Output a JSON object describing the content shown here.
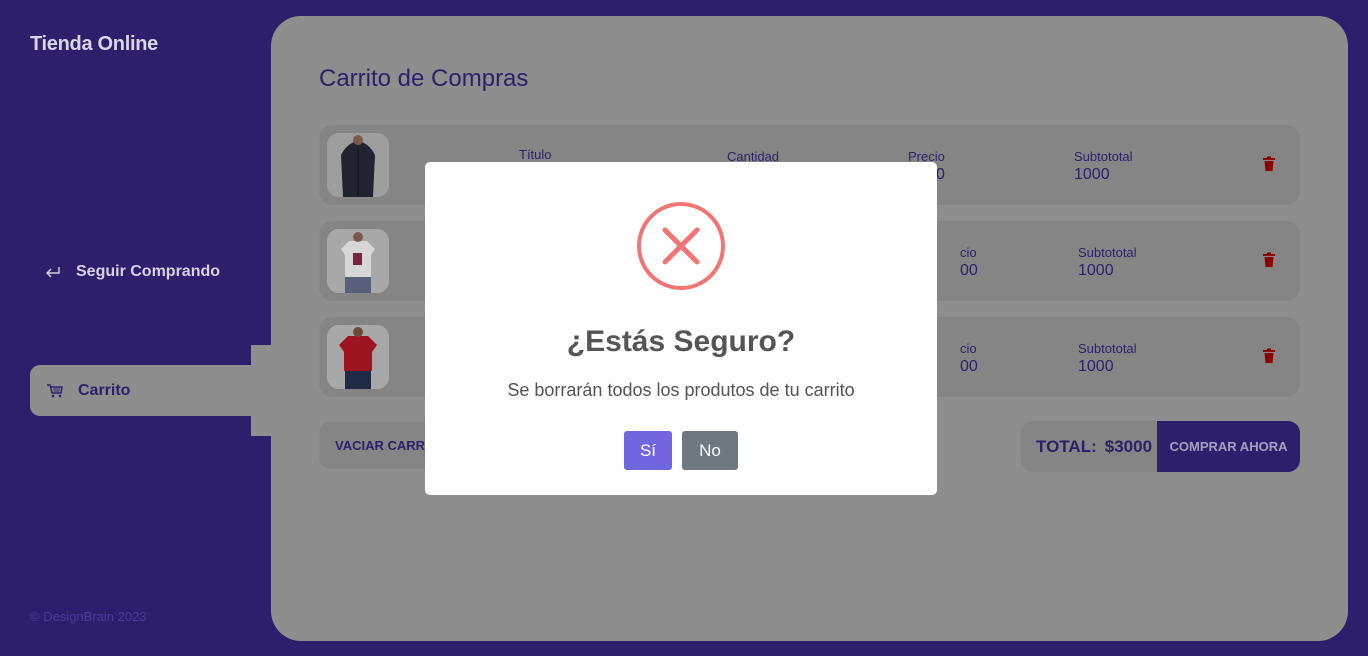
{
  "app": {
    "brand": "Tienda Online",
    "footer": "© DesignBrain 2023"
  },
  "sidebar": {
    "continue_label": "Seguir Comprando",
    "cart_label": "Carrito"
  },
  "main": {
    "title": "Carrito de Compras",
    "columns": {
      "title": "Título",
      "quantity": "Cantidad",
      "price": "Precio",
      "subtotal": "Subtototal"
    },
    "rows": [
      {
        "image": "jacket-photo",
        "price_partial": "0",
        "subtotal": "1000"
      },
      {
        "image": "white-tshirt-photo",
        "price_label_partial": "cio",
        "price_partial": "00",
        "subtotal": "1000"
      },
      {
        "image": "red-tshirt-photo",
        "price_label_partial": "cio",
        "price_partial": "00",
        "subtotal": "1000"
      }
    ],
    "empty_button": "VACIAR CARRIT",
    "total_label": "TOTAL:",
    "total_value": "$3000",
    "buy_button": "COMPRAR AHORA"
  },
  "modal": {
    "icon": "error-x-icon",
    "title": "¿Estás Seguro?",
    "text": "Se borrarán todos los produtos de tu carrito",
    "confirm": "Sí",
    "cancel": "No"
  },
  "colors": {
    "sidebar_bg": "#2d1f6b",
    "overlay_panel": "#8e8e8e",
    "confirm_button": "#7066e0",
    "cancel_button": "#6e7881",
    "error_icon": "#f27474",
    "trash_icon": "#8b0000"
  }
}
